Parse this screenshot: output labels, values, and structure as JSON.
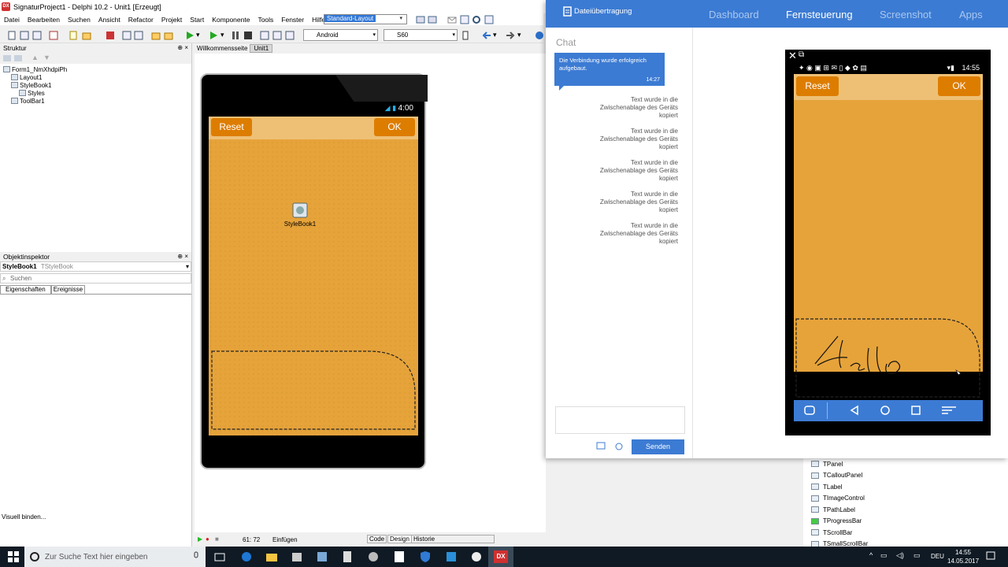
{
  "ide": {
    "title": "SignaturProject1 - Delphi 10.2 - Unit1 [Erzeugt]",
    "logo": "DX",
    "menu": [
      "Datei",
      "Bearbeiten",
      "Suchen",
      "Ansicht",
      "Refactor",
      "Projekt",
      "Start",
      "Komponente",
      "Tools",
      "Fenster",
      "Hilfe"
    ],
    "layout_combo": "Standard-Layout",
    "platform_combo": "Android",
    "device_combo": "S60",
    "structure": {
      "title": "Struktur",
      "tree": [
        {
          "label": "Form1_NmXhdpiPh",
          "indent": 0
        },
        {
          "label": "Layout1",
          "indent": 1
        },
        {
          "label": "StyleBook1",
          "indent": 1
        },
        {
          "label": "Styles",
          "indent": 2
        },
        {
          "label": "ToolBar1",
          "indent": 1
        }
      ]
    },
    "inspector": {
      "title": "Objektinspektor",
      "object_name": "StyleBook1",
      "object_type": "TStyleBook",
      "search_placeholder": "Suchen",
      "tabs": [
        "Eigenschaften",
        "Ereignisse"
      ]
    },
    "left_status": "Visuell binden...",
    "designer_tabs": [
      "Willkommensseite",
      "Unit1"
    ],
    "form": {
      "status_time": "4:00",
      "reset_label": "Reset",
      "ok_label": "OK",
      "component_label": "StyleBook1"
    },
    "status_bar": {
      "position": "61: 72",
      "mode": "Einfügen",
      "tabs": [
        "Code",
        "Design",
        "Historie"
      ]
    },
    "palette": [
      "TPanel",
      "TCalloutPanel",
      "TLabel",
      "TImageControl",
      "TPathLabel",
      "TProgressBar",
      "TScrollBar",
      "TSmallScrollBar"
    ]
  },
  "remote": {
    "file_transfer": "Dateiübertragung",
    "nav": [
      "Dashboard",
      "Fernsteuerung",
      "Screenshot",
      "Apps"
    ],
    "active_nav": "Fernsteuerung",
    "chat": {
      "title": "Chat",
      "bubble_text": "Die Verbindung wurde erfolgreich aufgebaut.",
      "bubble_time": "14:27",
      "messages": [
        "Text wurde in die Zwischenablage des Geräts kopiert",
        "Text wurde in die Zwischenablage des Geräts kopiert",
        "Text wurde in die Zwischenablage des Geräts kopiert",
        "Text wurde in die Zwischenablage des Geräts kopiert",
        "Text wurde in die Zwischenablage des Geräts kopiert"
      ],
      "send_label": "Senden"
    },
    "device": {
      "time": "14:55",
      "reset_label": "Reset",
      "ok_label": "OK"
    }
  },
  "taskbar": {
    "search_placeholder": "Zur Suche Text hier eingeben",
    "language": "DEU",
    "time": "14:55",
    "date": "14.05.2017"
  }
}
